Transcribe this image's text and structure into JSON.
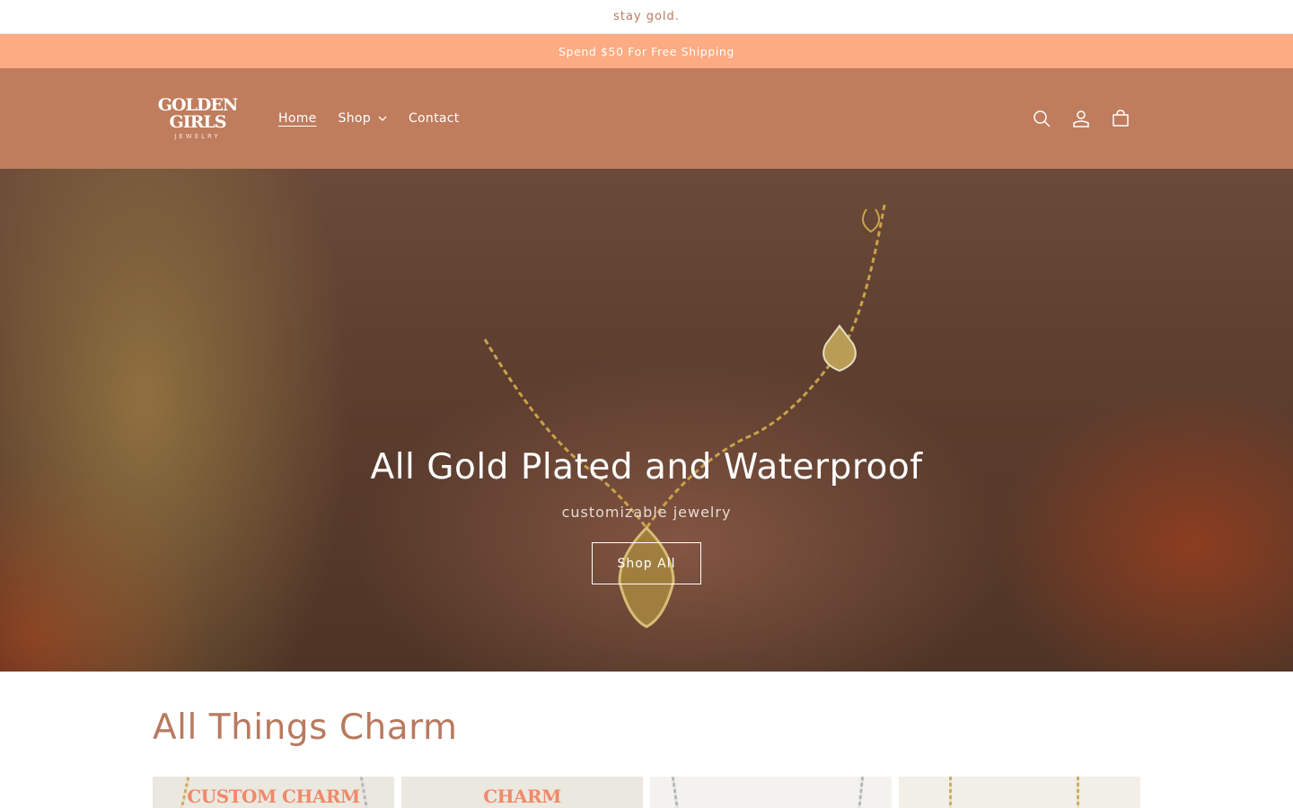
{
  "topbar": {
    "text": "stay gold."
  },
  "announcement": {
    "text": "Spend $50 For Free Shipping"
  },
  "header": {
    "logo": {
      "line1": "GOLDEN",
      "line2": "GIRLS",
      "line3": "JEWELRY"
    },
    "nav": [
      {
        "label": "Home",
        "active": true
      },
      {
        "label": "Shop",
        "has_dropdown": true
      },
      {
        "label": "Contact"
      }
    ],
    "icons": [
      "search-icon",
      "account-icon",
      "cart-icon"
    ]
  },
  "hero": {
    "title": "All Gold Plated and Waterproof",
    "subtitle": "customizable jewelry",
    "button_label": "Shop All"
  },
  "collection": {
    "title": "All Things Charm",
    "cards": [
      {
        "label": "CUSTOM CHARM"
      },
      {
        "label": "CHARM"
      },
      {
        "label": ""
      },
      {
        "label": ""
      }
    ]
  },
  "colors": {
    "accent": "#b87a5f",
    "announcement_bg": "#fdab82",
    "header_bg": "#bf7d5e"
  }
}
